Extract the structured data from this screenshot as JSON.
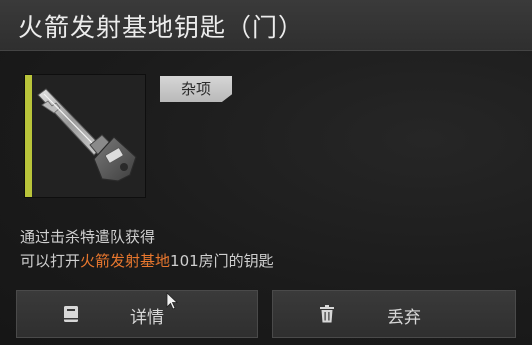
{
  "title": "火箭发射基地钥匙（门）",
  "item": {
    "icon": "key-icon",
    "category": "杂项",
    "rarity_color": "#b9c43a"
  },
  "description": {
    "line1": "通过击杀特遣队获得",
    "line2_prefix": "可以打开",
    "line2_highlight": "火箭发射基地",
    "line2_suffix": "101房门的钥匙",
    "highlight_color": "#e8772e"
  },
  "buttons": {
    "details_label": "详情",
    "details_icon": "book-icon",
    "discard_label": "丢弃",
    "discard_icon": "trash-icon"
  }
}
